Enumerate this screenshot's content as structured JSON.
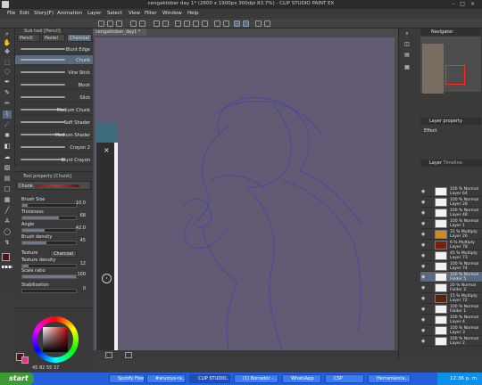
{
  "window": {
    "title": "cengaktober  day 1* (2600 x 1900px 300dpi 83.7%)  - CLIP STUDIO PAINT EX"
  },
  "menu": [
    "File",
    "Edit",
    "Story(F)",
    "Animation",
    "Layer",
    "Select",
    "View",
    "Filter",
    "Window",
    "Help"
  ],
  "subtool": {
    "header": "Sub tool [Pencil]",
    "tabs": [
      "Pencil",
      "Pastel",
      "Charcoal"
    ],
    "brushes": [
      "Blunt Edge",
      "Chunk",
      "Vine Stick",
      "Block",
      "Slick",
      "Medium Chunk",
      "Soft Shader",
      "Medium Shader",
      "Crayon 2",
      "Blunt Crayon"
    ],
    "selected_index": 1
  },
  "tool_property": {
    "header": "Tool property [Chunk]",
    "preset": "Chunk",
    "rows": [
      {
        "label": "Brush Size",
        "value": "10.0",
        "fraction": 0.1
      },
      {
        "label": "Thickness",
        "value": "68",
        "fraction": 0.68
      },
      {
        "label": "Angle",
        "value": "42.0",
        "fraction": 0.42
      },
      {
        "label": "Brush density",
        "value": "45",
        "fraction": 0.45
      },
      {
        "label": "Texture",
        "value": "Charcoal"
      },
      {
        "label": "Texture density",
        "value": "12",
        "fraction": 0.12
      },
      {
        "label": "Scale ratio",
        "value": "100",
        "fraction": 1.0
      },
      {
        "label": "Stabilization",
        "value": "0",
        "fraction": 0.0
      }
    ]
  },
  "color": {
    "main": "#5c1010",
    "sub": "#ff2a8a",
    "values": [
      "45",
      "82",
      "55",
      "37"
    ]
  },
  "canvas": {
    "doc_tab": "cengaktober_day1 *",
    "bg_color": "#625b73",
    "sketch_color": "#4a3fa8"
  },
  "navigator": {
    "header": "Navigator"
  },
  "layer_property": {
    "header": "Layer property",
    "effect_label": "Effect"
  },
  "layers": {
    "header": "Layer",
    "header_tab": "Timeline",
    "items": [
      {
        "l1": "100 % Normal",
        "l2": "Layer 64",
        "thumb": "#f2f2f2",
        "eye": true
      },
      {
        "l1": "100 % Normal",
        "l2": "Layer 28",
        "thumb": "#f2f2f2",
        "eye": true
      },
      {
        "l1": "100 % Normal",
        "l2": "Layer 48",
        "thumb": "#f2f2f2",
        "eye": true
      },
      {
        "l1": "100 % Normal",
        "l2": "Layer 1",
        "thumb": "#f2f2f2",
        "eye": true
      },
      {
        "l1": "31 % Multiply",
        "l2": "Layer 26",
        "thumb": "#d08a20",
        "eye": true
      },
      {
        "l1": "6 % Multiply",
        "l2": "Layer 78",
        "thumb": "#7a2010",
        "eye": true
      },
      {
        "l1": "45 % Multiply",
        "l2": "Layer 73",
        "thumb": "#f2f2f2",
        "eye": true
      },
      {
        "l1": "100 % Normal",
        "l2": "Layer 74",
        "thumb": "#f2f2f2",
        "eye": true
      },
      {
        "l1": "100 % Normal",
        "l2": "Folder 5",
        "thumb": "#f2f2f2",
        "eye": true,
        "selected": true
      },
      {
        "l1": "20 % Normal",
        "l2": "Folder 2",
        "thumb": "#f2f2f2",
        "eye": true
      },
      {
        "l1": "15 % Multiply",
        "l2": "Layer 72",
        "thumb": "#5a2010",
        "eye": true
      },
      {
        "l1": "100 % Normal",
        "l2": "Folder 1",
        "thumb": "#f2f2f2",
        "eye": true
      },
      {
        "l1": "100 % Normal",
        "l2": "Layer 4",
        "thumb": "#f2f2f2",
        "eye": true
      },
      {
        "l1": "100 % Normal",
        "l2": "Layer 3",
        "thumb": "#f2f2f2",
        "eye": true
      },
      {
        "l1": "100 % Normal",
        "l2": "Layer 2",
        "thumb": "#f2f2f2",
        "eye": true
      }
    ]
  },
  "taskbar": {
    "start": "start",
    "tasks": [
      {
        "label": "Spotify Free"
      },
      {
        "label": "#arumys-ra..."
      },
      {
        "label": "CLIP STUDIO...",
        "active": true
      },
      {
        "label": "(1) Borrador -..."
      },
      {
        "label": "WhatsApp"
      },
      {
        "label": "CSP"
      },
      {
        "label": "Herramienta..."
      }
    ],
    "clock": "12:36 p. m."
  }
}
